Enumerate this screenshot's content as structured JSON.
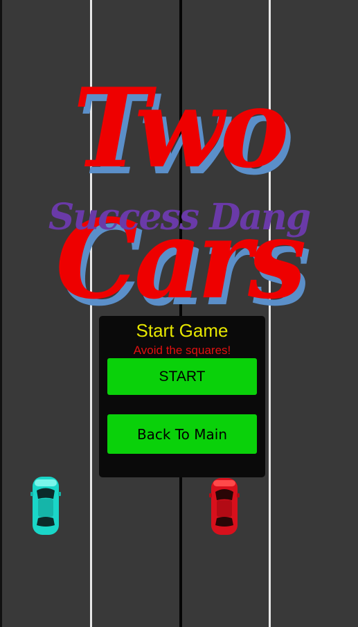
{
  "game": {
    "title": "Two Cars",
    "subtitle": "Success Dang"
  },
  "menu": {
    "title": "Start Game",
    "subtitle": "Avoid the squares!",
    "start_label": "START",
    "back_label": "Back To Main"
  },
  "cars": {
    "left_color": "#1ad6c8",
    "right_color": "#d8101c"
  },
  "colors": {
    "road": "#393939",
    "lane": "#e8e8e8",
    "title": "#ee0000",
    "title_shadow": "#5b8fc9",
    "subtitle": "#6a3aa8",
    "menu_title": "#e6e600",
    "menu_subtitle": "#e01010",
    "button": "#0ad10a"
  }
}
